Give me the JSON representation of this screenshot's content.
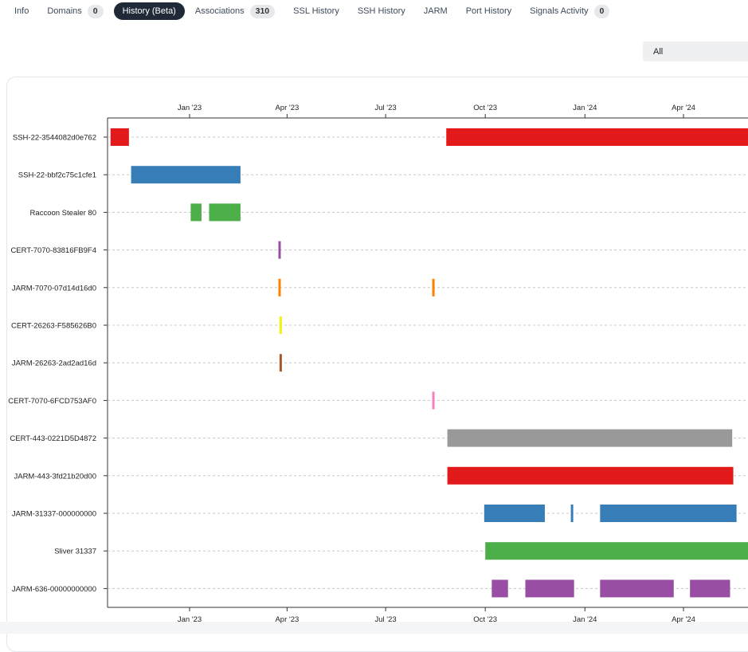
{
  "tabs": [
    {
      "label": "Info",
      "badge": null,
      "active": false
    },
    {
      "label": "Domains",
      "badge": "0",
      "active": false
    },
    {
      "label": "History (Beta)",
      "badge": null,
      "active": true
    },
    {
      "label": "Associations",
      "badge": "310",
      "active": false
    },
    {
      "label": "SSL History",
      "badge": null,
      "active": false
    },
    {
      "label": "SSH History",
      "badge": null,
      "active": false
    },
    {
      "label": "JARM",
      "badge": null,
      "active": false
    },
    {
      "label": "Port History",
      "badge": null,
      "active": false
    },
    {
      "label": "Signals Activity",
      "badge": "0",
      "active": false
    }
  ],
  "filter": {
    "selected": "All"
  },
  "chart_data": {
    "type": "timeline",
    "x_range": [
      "2022-10-15",
      "2024-06-12"
    ],
    "ticks": [
      {
        "date": "2023-01-01",
        "label": "Jan '23"
      },
      {
        "date": "2023-04-01",
        "label": "Apr '23"
      },
      {
        "date": "2023-07-01",
        "label": "Jul '23"
      },
      {
        "date": "2023-10-01",
        "label": "Oct '23"
      },
      {
        "date": "2024-01-01",
        "label": "Jan '24"
      },
      {
        "date": "2024-04-01",
        "label": "Apr '24"
      }
    ],
    "grid": true,
    "rows": [
      {
        "label": "SSH-22-3544082d0e762",
        "color": "#e31a1c",
        "intervals": [
          [
            "2022-10-20",
            "2022-11-06"
          ],
          [
            "2023-08-26",
            "2024-06-12"
          ]
        ]
      },
      {
        "label": "SSH-22-bbf2c75c1cfe1",
        "color": "#377eb8",
        "intervals": [
          [
            "2022-11-08",
            "2023-02-17"
          ]
        ]
      },
      {
        "label": "Raccoon Stealer 80",
        "color": "#4daf4a",
        "intervals": [
          [
            "2023-01-02",
            "2023-01-12"
          ],
          [
            "2023-01-19",
            "2023-02-17"
          ]
        ]
      },
      {
        "label": "CERT-7070-83816FB9F4",
        "color": "#984ea3",
        "intervals": [
          [
            "2023-03-24",
            "2023-03-26"
          ]
        ]
      },
      {
        "label": "JARM-7070-07d14d16d0",
        "color": "#ff7f00",
        "intervals": [
          [
            "2023-03-24",
            "2023-03-26"
          ],
          [
            "2023-07-44",
            "2023-08-14"
          ]
        ]
      },
      {
        "label": "CERT-26263-F585626B0",
        "color": "#f2f20f",
        "intervals": [
          [
            "2023-03-25",
            "2023-03-27"
          ]
        ]
      },
      {
        "label": "JARM-26263-2ad2ad16d",
        "color": "#a65628",
        "intervals": [
          [
            "2023-03-25",
            "2023-03-27"
          ]
        ]
      },
      {
        "label": "CERT-7070-6FCD753AF0",
        "color": "#f781bf",
        "intervals": [
          [
            "2023-08-13",
            "2023-08-15"
          ]
        ]
      },
      {
        "label": "CERT-443-0221D5D4872",
        "color": "#999999",
        "intervals": [
          [
            "2023-08-27",
            "2024-05-16"
          ]
        ]
      },
      {
        "label": "JARM-443-3fd21b20d00",
        "color": "#e31a1c",
        "intervals": [
          [
            "2023-08-27",
            "2024-05-17"
          ]
        ]
      },
      {
        "label": "JARM-31337-000000000",
        "color": "#377eb8",
        "intervals": [
          [
            "2023-09-30",
            "2023-11-25"
          ],
          [
            "2023-12-19",
            "2023-12-21"
          ],
          [
            "2024-01-15",
            "2024-05-20"
          ]
        ]
      },
      {
        "label": "Sliver 31337",
        "color": "#4daf4a",
        "intervals": [
          [
            "2023-10-01",
            "2024-06-12"
          ]
        ]
      },
      {
        "label": "JARM-636-00000000000",
        "color": "#984ea3",
        "intervals": [
          [
            "2023-10-07",
            "2023-10-22"
          ],
          [
            "2023-11-07",
            "2023-12-22"
          ],
          [
            "2024-01-15",
            "2024-03-23"
          ],
          [
            "2024-04-07",
            "2024-05-14"
          ]
        ]
      }
    ]
  }
}
